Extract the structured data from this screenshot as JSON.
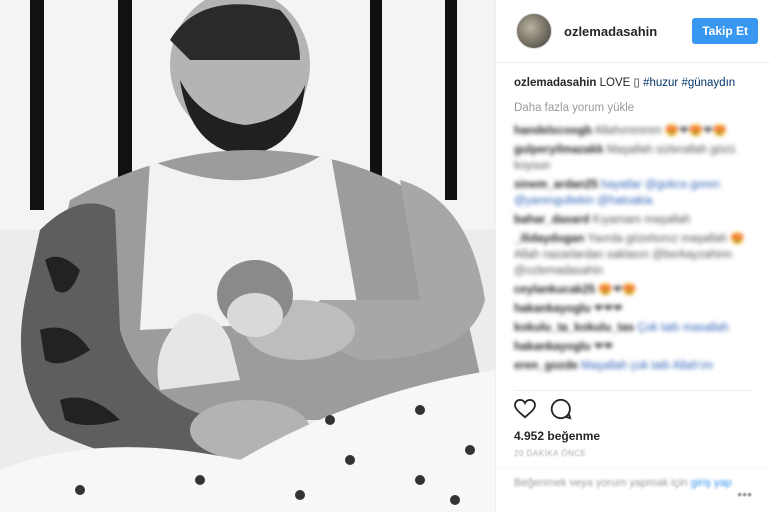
{
  "header": {
    "username": "ozlemadasahin",
    "follow_label": "Takip Et"
  },
  "caption": {
    "username": "ozlemadasahin",
    "text": "LOVE ▯",
    "tag1": "#huzur",
    "tag2": "#günaydın"
  },
  "load_more": "Daha fazla yorum yükle",
  "comments": [
    {
      "user": "handelxcoogb",
      "text": "Allahımmmm 😍❤😍❤😍"
    },
    {
      "user": "gulperyilmazakk",
      "text": "Maşallah sizlerallah gözü koysun"
    },
    {
      "user": "sinem_ardan25",
      "text": "hayatlar @gokce.goren @yarengultekin @hatoakia"
    },
    {
      "user": "bahar_daxard",
      "text": "Kıyamam maşallah"
    },
    {
      "user": "_ilidaydogan",
      "text": "Yavrda gözelsınız maşallah 😍 Allah nazarlardan saklasın @berkayzahinn @ozlemadasahin"
    },
    {
      "user": "ceylankucak25",
      "text": "😍❤😍"
    },
    {
      "user": "hakankayoglu",
      "text": "❤❤❤"
    },
    {
      "user": "kokulu_ta_kokulu_tas",
      "text": "Çok tatlı masallah"
    },
    {
      "user": "hakankayoglu",
      "text": "❤❤"
    },
    {
      "user": "eren_gozde",
      "text": "Maşallah çok tatlı Allah'ım"
    }
  ],
  "likes": {
    "count": "4.952",
    "label": "beğenme"
  },
  "time": "20 DAKİKA ÖNCE",
  "add_comment": {
    "text": "Beğenmek veya yorum yapmak için",
    "link": "giriş yap"
  },
  "icons": {
    "like": "heart-icon",
    "comment": "comment-icon",
    "more": "more-dots-icon"
  },
  "colors": {
    "follow_button": "#3897f0",
    "hashtag": "#003569"
  }
}
